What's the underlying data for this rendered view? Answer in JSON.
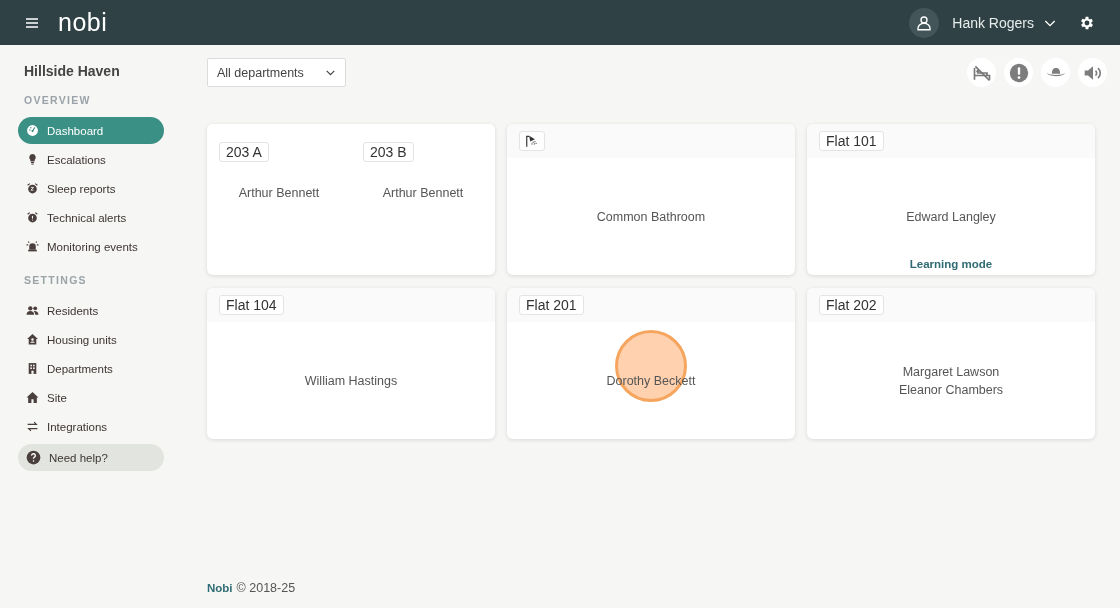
{
  "topbar": {
    "logo": "nobi",
    "user": "Hank Rogers"
  },
  "sidebar": {
    "site": "Hillside Haven",
    "sections": [
      {
        "heading": "OVERVIEW",
        "items": [
          {
            "label": "Dashboard",
            "selected": true
          },
          {
            "label": "Escalations",
            "selected": false
          },
          {
            "label": "Sleep reports",
            "selected": false
          },
          {
            "label": "Technical alerts",
            "selected": false
          },
          {
            "label": "Monitoring events",
            "selected": false
          }
        ]
      },
      {
        "heading": "SETTINGS",
        "items": [
          {
            "label": "Residents",
            "selected": false
          },
          {
            "label": "Housing units",
            "selected": false
          },
          {
            "label": "Departments",
            "selected": false
          },
          {
            "label": "Site",
            "selected": false
          },
          {
            "label": "Integrations",
            "selected": false
          }
        ]
      }
    ],
    "help": "Need help?"
  },
  "filter": {
    "value": "All departments"
  },
  "cards": [
    {
      "units": [
        {
          "kind": "label",
          "label": "203 A",
          "names": [
            "Arthur Bennett"
          ]
        },
        {
          "kind": "label",
          "label": "203 B",
          "names": [
            "Arthur Bennett"
          ]
        }
      ],
      "click_marker": false
    },
    {
      "units": [
        {
          "kind": "shower",
          "names": [
            "Common Bathroom"
          ]
        }
      ],
      "click_marker": false
    },
    {
      "units": [
        {
          "kind": "label",
          "label": "Flat 101",
          "names": [
            "Edward Langley"
          ]
        }
      ],
      "mode": "Learning mode",
      "click_marker": false
    },
    {
      "units": [
        {
          "kind": "label",
          "label": "Flat 104",
          "names": [
            "William Hastings"
          ]
        }
      ],
      "click_marker": false
    },
    {
      "units": [
        {
          "kind": "label",
          "label": "Flat 201",
          "names": [
            "Dorothy Beckett"
          ]
        }
      ],
      "click_marker": true
    },
    {
      "units": [
        {
          "kind": "label",
          "label": "Flat 202",
          "names": [
            "Margaret Lawson",
            "Eleanor Chambers"
          ]
        }
      ],
      "click_marker": false
    }
  ],
  "footer": {
    "brand": "Nobi",
    "copyright": "© 2018-25"
  }
}
